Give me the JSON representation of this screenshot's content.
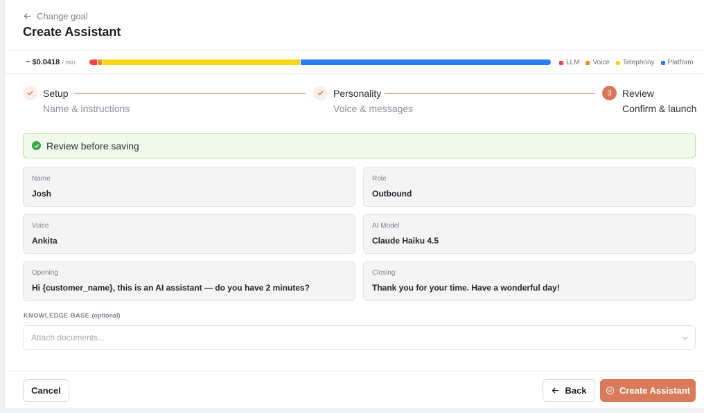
{
  "header": {
    "back_label": "Change goal",
    "title": "Create Assistant"
  },
  "cost": {
    "amount": "~ $0.0418",
    "unit": "/ min",
    "breakdown": [
      {
        "name": "LLM",
        "fraction": 0.016,
        "color": "#ef4444"
      },
      {
        "name": "Voice",
        "fraction": 0.009,
        "color": "#f08a2c"
      },
      {
        "name": "Telephony",
        "fraction": 0.43,
        "color": "#fbd617"
      },
      {
        "name": "Platform",
        "fraction": 0.545,
        "color": "#2b7ef6"
      }
    ]
  },
  "steps": [
    {
      "title": "Setup",
      "subtitle": "Name & instructions",
      "status": "done",
      "icon": "check-icon"
    },
    {
      "title": "Personality",
      "subtitle": "Voice & messages",
      "status": "done",
      "icon": "check-icon"
    },
    {
      "number": "3",
      "title": "Review",
      "subtitle": "Confirm & launch",
      "status": "active"
    }
  ],
  "banner": {
    "text": "Review before saving",
    "icon": "check-circle-icon",
    "color": "#3aa64a"
  },
  "fields": {
    "name": {
      "label": "Name",
      "value": "Josh"
    },
    "role": {
      "label": "Role",
      "value": "Outbound"
    },
    "voice": {
      "label": "Voice",
      "value": "Ankita"
    },
    "model": {
      "label": "AI Model",
      "value": "Claude Haiku 4.5"
    },
    "opening": {
      "label": "Opening",
      "value": "Hi {customer_name}, this is an AI assistant — do you have 2 minutes?"
    },
    "closing": {
      "label": "Closing",
      "value": "Thank you for your time. Have a wonderful day!"
    }
  },
  "knowledge_base": {
    "label": "KNOWLEDGE BASE",
    "optional": "(optional)",
    "placeholder": "Attach documents..."
  },
  "footer": {
    "cancel_label": "Cancel",
    "back_label": "Back",
    "create_label": "Create Assistant"
  },
  "colors": {
    "accent": "#d97a5b",
    "success": "#3aa64a"
  }
}
